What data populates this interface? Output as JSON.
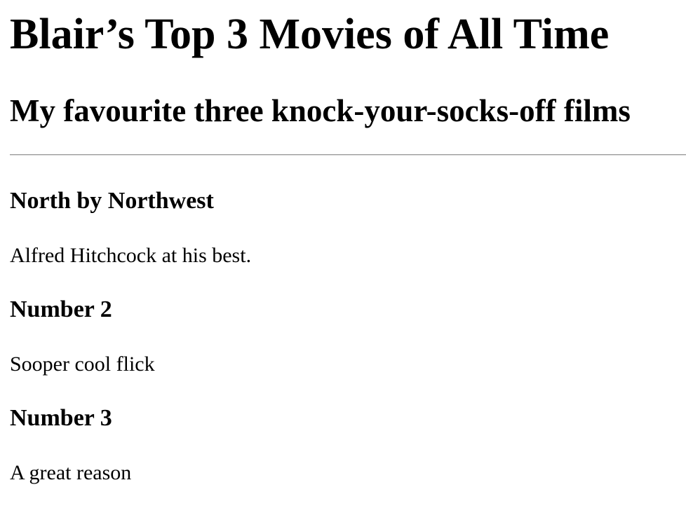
{
  "page": {
    "title": "Blair’s Top 3 Movies of All Time",
    "subtitle": "My favourite three knock-your-socks-off films"
  },
  "movies": [
    {
      "title": "North by Northwest",
      "description": "Alfred Hitchcock at his best."
    },
    {
      "title": "Number 2",
      "description": "Sooper cool flick"
    },
    {
      "title": "Number 3",
      "description": "A great reason"
    }
  ]
}
